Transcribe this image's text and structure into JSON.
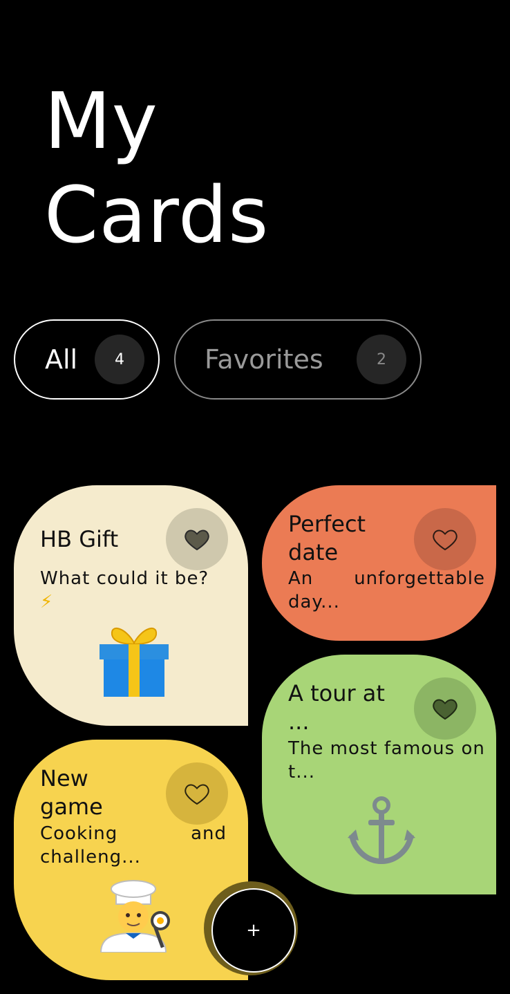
{
  "header": {
    "title_line1": "My",
    "title_line2": "Cards"
  },
  "tabs": [
    {
      "label": "All",
      "count": "4"
    },
    {
      "label": "Favorites",
      "count": "2"
    }
  ],
  "cards": [
    {
      "title": "HB Gift",
      "description": "What could it be?",
      "desc_emoji": "⚡",
      "emoji": "🎁",
      "favorite": true,
      "color": "#f5ebcd"
    },
    {
      "title": "Perfect date",
      "description": "An unforgettable day...",
      "emoji": "",
      "favorite": false,
      "color": "#eb7b54"
    },
    {
      "title": "A tour at ...",
      "description": "The most famous on t...",
      "emoji": "⚓",
      "favorite": true,
      "color": "#a8d577"
    },
    {
      "title": "New game",
      "description": "Cooking and challeng...",
      "emoji": "🧑‍🍳",
      "favorite": false,
      "color": "#f7d34f"
    }
  ],
  "add_button": {
    "label": "+"
  },
  "icons": {
    "favorite": "heart-icon"
  }
}
